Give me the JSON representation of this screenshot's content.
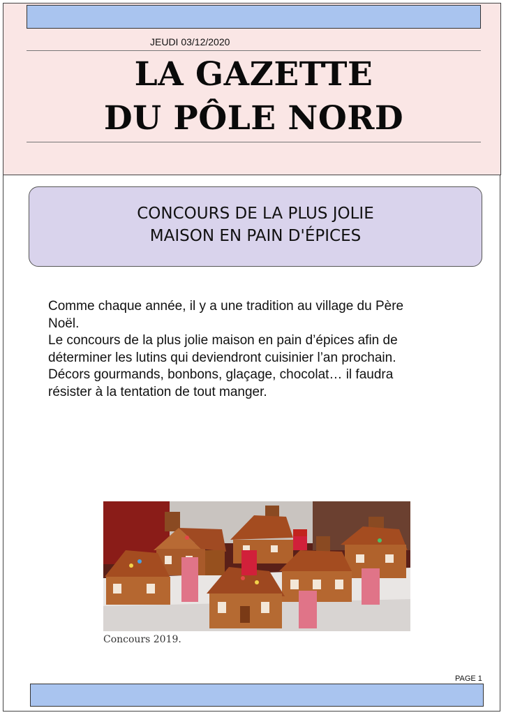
{
  "header": {
    "date": "JEUDI 03/12/2020",
    "title_line1": "LA GAZETTE",
    "title_line2": "DU PÔLE NORD"
  },
  "article": {
    "headline_line1": "CONCOURS DE LA PLUS JOLIE",
    "headline_line2": "MAISON EN PAIN D'ÉPICES",
    "body_lines": [
      "Comme chaque année, il y a une tradition au village du Père",
      "Noël.",
      "Le concours de la plus jolie maison en pain d’épices afin de",
      "déterminer les lutins qui deviendront cuisinier l’an prochain.",
      "Décors gourmands, bonbons, glaçage, chocolat… il faudra",
      "résister à la tentation de tout manger."
    ],
    "photo_caption": "Concours 2019."
  },
  "footer": {
    "page_label": "PAGE 1"
  },
  "colors": {
    "masthead_bg": "#fae6e5",
    "bar_blue": "#a9c4ef",
    "headline_box_bg": "#d9d3ec"
  }
}
